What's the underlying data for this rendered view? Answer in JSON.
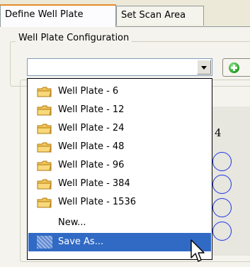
{
  "tabs": [
    {
      "label": "Define Well Plate",
      "active": true
    },
    {
      "label": "Set Scan Area",
      "active": false
    }
  ],
  "group": {
    "legend": "Well Plate Configuration"
  },
  "combo": {
    "value": ""
  },
  "dropdown": {
    "items": [
      {
        "label": "Well Plate - 6",
        "icon": "folder-icon"
      },
      {
        "label": "Well Plate - 12",
        "icon": "folder-icon"
      },
      {
        "label": "Well Plate - 24",
        "icon": "folder-icon"
      },
      {
        "label": "Well Plate - 48",
        "icon": "folder-icon"
      },
      {
        "label": "Well Plate - 96",
        "icon": "folder-icon"
      },
      {
        "label": "Well Plate - 384",
        "icon": "folder-icon"
      },
      {
        "label": "Well Plate - 1536",
        "icon": "folder-icon"
      },
      {
        "label": "New...",
        "icon": ""
      },
      {
        "label": "Save As...",
        "icon": "selection-icon",
        "selected": true
      }
    ]
  },
  "plate": {
    "column_label": "4",
    "well_color": "#1f36e6"
  },
  "colors": {
    "selection": "#316ac5",
    "tab_accent": "#e68b2c"
  }
}
